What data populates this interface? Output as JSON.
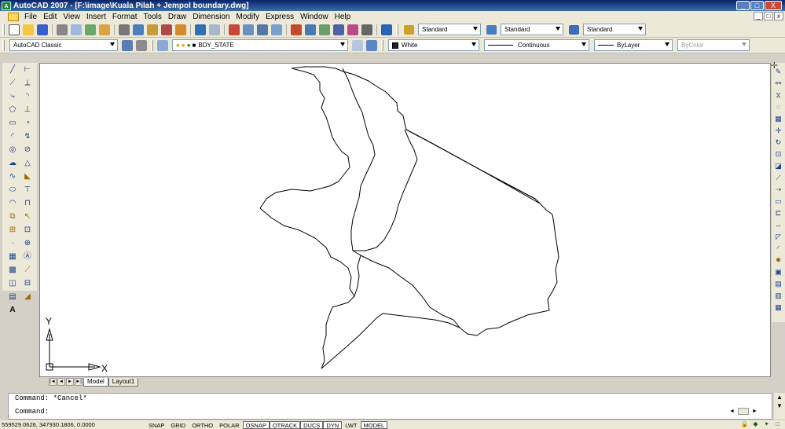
{
  "window": {
    "app_icon": "autocad-icon",
    "title": "AutoCAD 2007 - [F:\\image\\Kuala Pilah + Jempol boundary.dwg]",
    "controls": [
      "_",
      "□",
      "X"
    ]
  },
  "menu": {
    "items": [
      "File",
      "Edit",
      "View",
      "Insert",
      "Format",
      "Tools",
      "Draw",
      "Dimension",
      "Modify",
      "Express",
      "Window",
      "Help"
    ],
    "mdi_controls": [
      "_",
      "□",
      "x"
    ]
  },
  "styles_toolbar": {
    "text_style": "Standard",
    "dim_style": "Standard",
    "table_style": "Standard"
  },
  "workspace_toolbar": {
    "workspace": "AutoCAD Classic",
    "layer": "BDY_STATE",
    "color": "White",
    "linetype": "Continuous",
    "lineweight": "ByLayer",
    "plot_style": "ByColor"
  },
  "draw_tools": [
    "line-icon",
    "construction-line-icon",
    "polyline-icon",
    "polygon-icon",
    "rectangle-icon",
    "arc-icon",
    "circle-icon",
    "revision-cloud-icon",
    "spline-icon",
    "ellipse-icon",
    "ellipse-arc-icon",
    "insert-block-icon",
    "make-block-icon",
    "point-icon",
    "hatch-icon",
    "gradient-icon",
    "region-icon",
    "table-icon",
    "multiline-text-icon"
  ],
  "dimension_tools": [
    "linear-dim-icon",
    "aligned-dim-icon",
    "arc-length-icon",
    "ordinate-dim-icon",
    "radius-dim-icon",
    "jogged-dim-icon",
    "diameter-dim-icon",
    "angular-dim-icon",
    "quick-dim-icon",
    "baseline-dim-icon",
    "continue-dim-icon",
    "quick-leader-icon",
    "tolerance-icon",
    "center-mark-icon",
    "dim-edit-icon",
    "dim-text-edit-icon",
    "dim-update-icon",
    "dim-style-icon"
  ],
  "modify_tools": [
    "erase-icon",
    "copy-icon",
    "mirror-icon",
    "offset-icon",
    "array-icon",
    "move-icon",
    "rotate-icon",
    "scale-icon",
    "stretch-icon",
    "trim-icon",
    "extend-icon",
    "break-at-point-icon",
    "break-icon",
    "join-icon",
    "chamfer-icon",
    "fillet-icon",
    "explode-icon",
    "draworder-front-icon",
    "draworder-back-icon",
    "draworder-above-icon",
    "draworder-under-icon"
  ],
  "ucs": {
    "x_label": "X",
    "y_label": "Y"
  },
  "layout_tabs": {
    "nav": [
      "|◄",
      "◄",
      "►",
      "►|"
    ],
    "tabs": [
      "Model",
      "Layout1"
    ],
    "active": "Model"
  },
  "command_line": {
    "history": "Command: *Cancel*",
    "prompt": "Command:"
  },
  "status": {
    "coordinates": "559529.0626, 347930.1806, 0.0000",
    "toggles": [
      {
        "label": "SNAP",
        "on": false
      },
      {
        "label": "GRID",
        "on": false
      },
      {
        "label": "ORTHO",
        "on": false
      },
      {
        "label": "POLAR",
        "on": false
      },
      {
        "label": "OSNAP",
        "on": true
      },
      {
        "label": "OTRACK",
        "on": true
      },
      {
        "label": "DUCS",
        "on": true
      },
      {
        "label": "DYN",
        "on": true
      },
      {
        "label": "LWT",
        "on": false
      },
      {
        "label": "MODEL",
        "on": true
      }
    ]
  }
}
